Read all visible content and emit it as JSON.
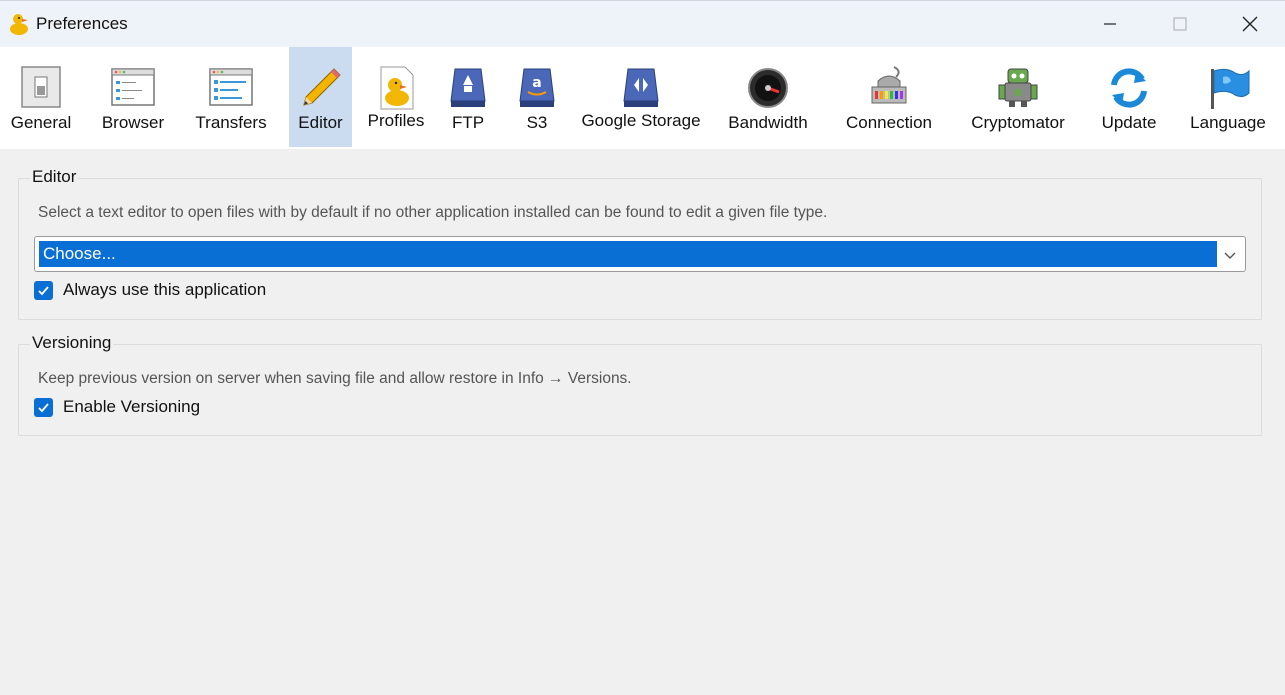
{
  "window": {
    "title": "Preferences"
  },
  "toolbar": {
    "items": [
      {
        "label": "General",
        "icon": "switch-icon"
      },
      {
        "label": "Browser",
        "icon": "browser-window-icon"
      },
      {
        "label": "Transfers",
        "icon": "transfers-window-icon"
      },
      {
        "label": "Editor",
        "icon": "pencil-icon",
        "selected": true
      },
      {
        "label": "Profiles",
        "icon": "duck-document-icon"
      },
      {
        "label": "FTP",
        "icon": "ftp-drive-icon"
      },
      {
        "label": "S3",
        "icon": "amazon-drive-icon"
      },
      {
        "label": "Google Storage",
        "icon": "google-drive-icon"
      },
      {
        "label": "Bandwidth",
        "icon": "gauge-icon"
      },
      {
        "label": "Connection",
        "icon": "network-adapter-icon"
      },
      {
        "label": "Cryptomator",
        "icon": "robot-icon"
      },
      {
        "label": "Update",
        "icon": "refresh-icon"
      },
      {
        "label": "Language",
        "icon": "flag-icon"
      }
    ]
  },
  "editor": {
    "title": "Editor",
    "description": "Select a text editor to open files with by default if no other application installed can be found to edit a given file type.",
    "selected_editor": "Choose...",
    "always_use_label": "Always use this application",
    "always_use_checked": true
  },
  "versioning": {
    "title": "Versioning",
    "description": "Keep previous version on server when saving file and allow restore in Info → Versions.",
    "enable_label": "Enable Versioning",
    "enable_checked": true
  },
  "colors": {
    "accent": "#0a6fd4",
    "selected_tab": "#cbdcf0",
    "background": "#f0f0f0"
  }
}
